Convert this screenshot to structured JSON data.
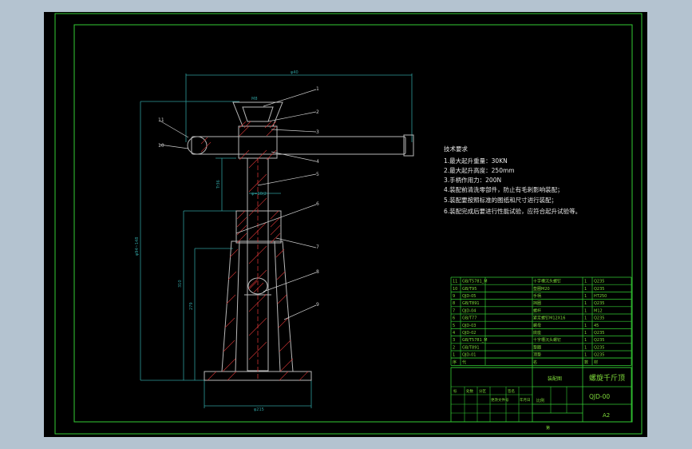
{
  "colors": {
    "background": "#b4c3d0",
    "canvas": "#000000",
    "frame": "#33cc33",
    "part": "#b8b8b8",
    "hatch": "#cc3333",
    "dim": "#2f9c9c",
    "leader": "#cccccc",
    "text": "#e8e8e8",
    "table_text": "#7fdc3a"
  },
  "dimensions": {
    "width": "φ40",
    "gap": "M8",
    "shaft": "φ=10(2",
    "height_total": "φ94~148",
    "h1": "310",
    "h2": "279",
    "thread": "Tr36",
    "base": "φ215"
  },
  "balloons": [
    "1",
    "2",
    "3",
    "4",
    "5",
    "6",
    "7",
    "8",
    "9",
    "10",
    "11"
  ],
  "tech_requirements": {
    "title": "技术要求",
    "items": [
      "1.最大起升重量：30KN",
      "2.最大起升高度：250mm",
      "3.手柄作用力：200N",
      "4.装配前清洗零部件，防止有毛刺影响装配；",
      "5.装配要按照标准的图纸和尺寸进行装配；",
      "6.装配完成后要进行性能试验，应符合起升试验等。"
    ]
  },
  "parts_list": [
    [
      "11",
      "GB/T5781_M",
      "十字槽沉头螺钉",
      "1",
      "Q235"
    ],
    [
      "10",
      "GB/T95",
      "垫圈M20",
      "1",
      "Q235"
    ],
    [
      "9",
      "QJD-05",
      "手柄",
      "1",
      "HT250"
    ],
    [
      "8",
      "GB/T891",
      "挡圈",
      "1",
      "Q235"
    ],
    [
      "7",
      "QJD-04",
      "螺杆",
      "1",
      "M12"
    ],
    [
      "6",
      "GB/T77",
      "紧定螺钉M12X16",
      "1",
      "Q235"
    ],
    [
      "5",
      "QJD-03",
      "螺母",
      "1",
      "45"
    ],
    [
      "4",
      "QJD-02",
      "底座",
      "1",
      "Q235"
    ],
    [
      "3",
      "GB/T5781_M",
      "十字槽沉头螺钉",
      "1",
      "Q235"
    ],
    [
      "2",
      "GB/T891",
      "垫圈",
      "1",
      "Q235"
    ],
    [
      "1",
      "QJD-01",
      "顶垫",
      "1",
      "Q235"
    ]
  ],
  "parts_header": [
    "序",
    "代",
    "名",
    "数",
    "材"
  ],
  "title_block": {
    "title": "螺旋千斤顶",
    "drawing_no": "QJD-00",
    "size": "A2",
    "assembly": "装配图",
    "scale": "比例",
    "sheet": "第",
    "notes": [
      "标",
      "处数",
      "分区",
      "更改文件号",
      "签名",
      "年月日"
    ]
  }
}
